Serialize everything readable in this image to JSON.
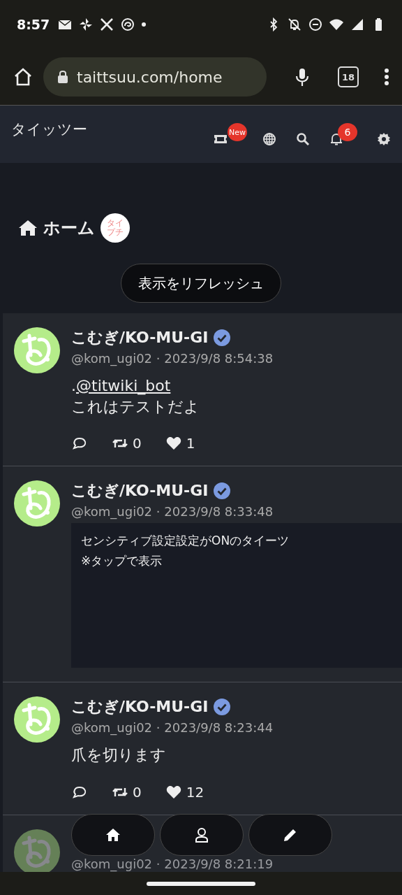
{
  "status_bar": {
    "time": "8:57"
  },
  "browser": {
    "url": "taittsuu.com/home",
    "tab_count": "18"
  },
  "header": {
    "title": "タイッツー",
    "new_badge": "New",
    "notification_count": "6"
  },
  "page": {
    "title": "ホーム",
    "sticker_lines": [
      "タイ",
      "プチ"
    ],
    "refresh_button": "表示をリフレッシュ"
  },
  "posts": [
    {
      "kind": "text",
      "name": "こむぎ/KO-MU-GI",
      "verified": true,
      "handle": "@kom_ugi02",
      "separator": "·",
      "time": "2023/9/8 8:54:38",
      "prefix": ".",
      "mention": "@titwiki_bot",
      "text": "これはテストだよ",
      "retweets": "0",
      "likes": "1"
    },
    {
      "kind": "sensitive",
      "name": "こむぎ/KO-MU-GI",
      "verified": true,
      "handle": "@kom_ugi02",
      "separator": "·",
      "time": "2023/9/8 8:33:48",
      "notice": "センシティブ設定設定がONのタイーツ",
      "hint": "※タップで表示"
    },
    {
      "kind": "text",
      "name": "こむぎ/KO-MU-GI",
      "verified": true,
      "handle": "@kom_ugi02",
      "separator": "·",
      "time": "2023/9/8 8:23:44",
      "text": "爪を切ります",
      "retweets": "0",
      "likes": "12"
    },
    {
      "kind": "partial",
      "handle": "@kom_ugi02",
      "separator": "·",
      "time": "2023/9/8 8:21:19"
    }
  ]
}
